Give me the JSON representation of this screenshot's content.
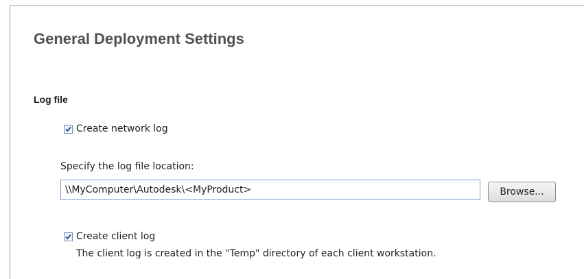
{
  "page": {
    "title": "General Deployment Settings"
  },
  "log_file": {
    "section_title": "Log file",
    "network_log": {
      "checked": true,
      "label": "Create network log"
    },
    "location_label": "Specify the log file location:",
    "location_value": "\\\\MyComputer\\Autodesk\\<MyProduct>",
    "browse_label": "Browse...",
    "client_log": {
      "checked": true,
      "label": "Create client log",
      "description": "The client log is created in the \"Temp\" directory of each client workstation."
    }
  }
}
